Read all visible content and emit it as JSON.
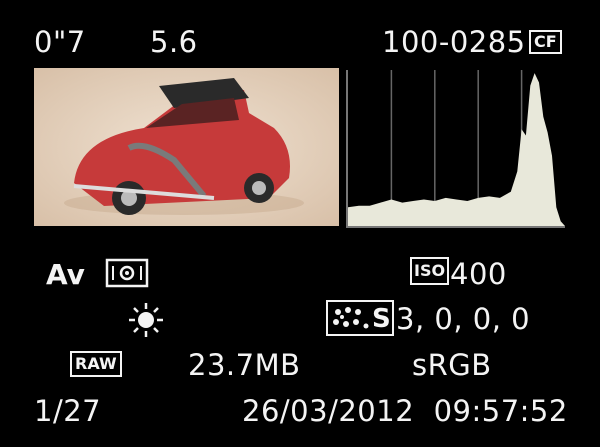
{
  "screen": {
    "shutter": "0\"7",
    "aperture": "5.6",
    "file_number": "100-0285",
    "card_badge": "CF",
    "mode": "Av",
    "iso_badge": "ISO",
    "iso_value": "400",
    "style_badge": "S",
    "style_values": "3,  0,  0,  0",
    "quality_badge": "RAW",
    "file_size": "23.7MB",
    "color_space": "sRGB",
    "frame_counter": "1/27",
    "datetime": "26/03/2012  09:57:52"
  },
  "icons": {
    "card": "cf-card-icon",
    "metering": "evaluative-metering-icon",
    "white_balance": "daylight-icon",
    "picture_style": "picture-style-icon"
  },
  "histogram": {
    "type": "area",
    "x": [
      0,
      5,
      10,
      15,
      20,
      25,
      30,
      35,
      40,
      45,
      50,
      55,
      60,
      65,
      70,
      75,
      78,
      80,
      82,
      84,
      86,
      88,
      90,
      92,
      94,
      96,
      98,
      100
    ],
    "values": [
      12,
      13,
      13,
      15,
      17,
      15,
      16,
      17,
      16,
      18,
      17,
      16,
      18,
      19,
      18,
      22,
      35,
      62,
      58,
      90,
      98,
      92,
      70,
      60,
      45,
      12,
      3,
      0
    ],
    "ylim": [
      0,
      100
    ],
    "color": "#e8e8da"
  }
}
